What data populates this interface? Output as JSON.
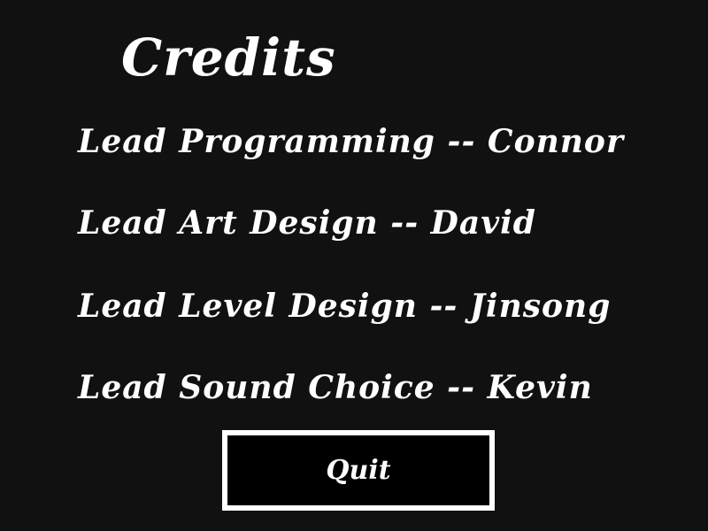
{
  "screen": {
    "title": "Credits"
  },
  "credits": [
    {
      "text": "Lead Programming -- Connor"
    },
    {
      "text": "Lead Art Design -- David"
    },
    {
      "text": "Lead Level Design -- Jinsong"
    },
    {
      "text": "Lead Sound Choice -- Kevin"
    }
  ],
  "actions": {
    "quit_label": "Quit"
  },
  "colors": {
    "background": "#111111",
    "text": "#ffffff",
    "button_background": "#000000",
    "button_border": "#ffffff"
  }
}
